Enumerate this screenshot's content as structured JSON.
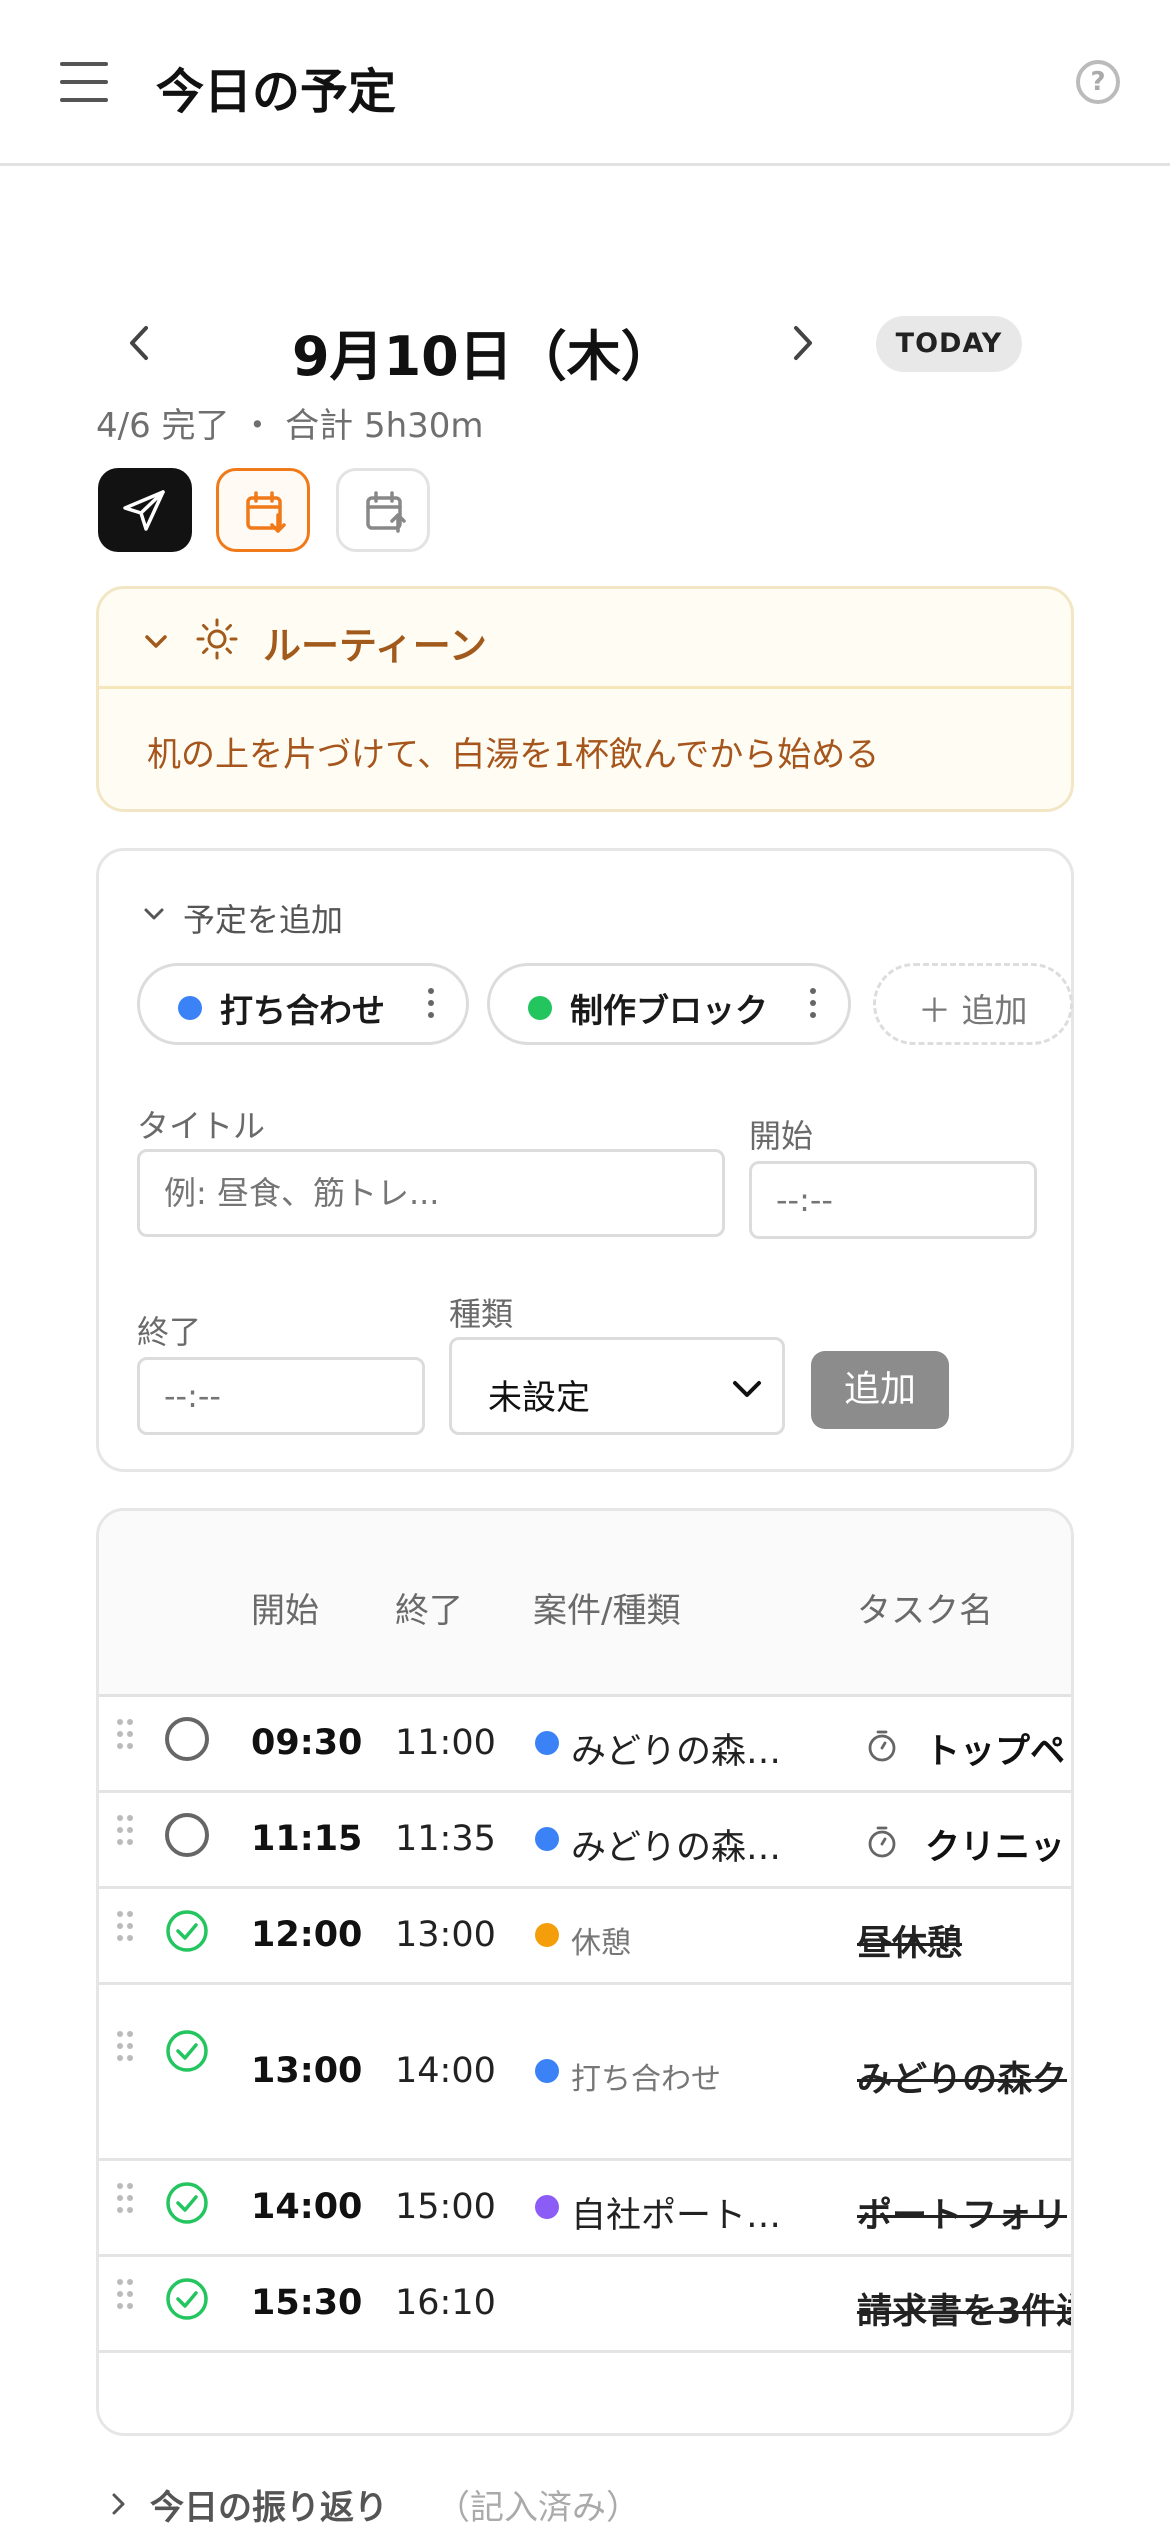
{
  "header": {
    "title": "今日の予定",
    "help_icon": "question-circle-icon",
    "menu_icon": "hamburger-icon"
  },
  "date_nav": {
    "date": "9月10日（木）",
    "today_label": "TODAY"
  },
  "summary": "4/6 完了 ・ 合計 5h30m",
  "routine": {
    "title": "ルーティーン",
    "text": "机の上を片づけて、白湯を1杯飲んでから始める"
  },
  "add_panel": {
    "heading": "予定を追加",
    "chips": [
      {
        "label": "打ち合わせ",
        "color": "#3b82f6"
      },
      {
        "label": "制作ブロック",
        "color": "#22c55e"
      }
    ],
    "add_chip_label": "＋ 追加",
    "title_label": "タイトル",
    "title_placeholder": "例: 昼食、筋トレ...",
    "start_label": "開始",
    "start_placeholder": "--:--",
    "end_label": "終了",
    "end_placeholder": "--:--",
    "type_label": "種類",
    "type_value": "未設定",
    "submit_label": "追加"
  },
  "table": {
    "headers": [
      "開始",
      "終了",
      "案件/種類",
      "タスク名"
    ],
    "rows": [
      {
        "start": "09:30",
        "end": "11:00",
        "project": "みどりの森…",
        "project_color": "#3b82f6",
        "task": "トップペ",
        "done": false,
        "timer": true
      },
      {
        "start": "11:15",
        "end": "11:35",
        "project": "みどりの森…",
        "project_color": "#3b82f6",
        "task": "クリニッ",
        "done": false,
        "timer": true
      },
      {
        "start": "12:00",
        "end": "13:00",
        "project": "休憩",
        "project_color": "#f59e0b",
        "task": "昼休憩",
        "done": true,
        "timer": false
      },
      {
        "start": "13:00",
        "end": "14:00",
        "project": "打ち合わせ",
        "project_color": "#3b82f6",
        "task": "みどりの森ク",
        "done": true,
        "timer": false
      },
      {
        "start": "14:00",
        "end": "15:00",
        "project": "自社ポート…",
        "project_color": "#8b5cf6",
        "task": "ポートフォリ",
        "done": true,
        "timer": false
      },
      {
        "start": "15:30",
        "end": "16:10",
        "project": "",
        "project_color": "",
        "task": "請求書を3件送",
        "done": true,
        "timer": false
      }
    ]
  },
  "reflection": {
    "title": "今日の振り返り",
    "status": "（記入済み）"
  }
}
